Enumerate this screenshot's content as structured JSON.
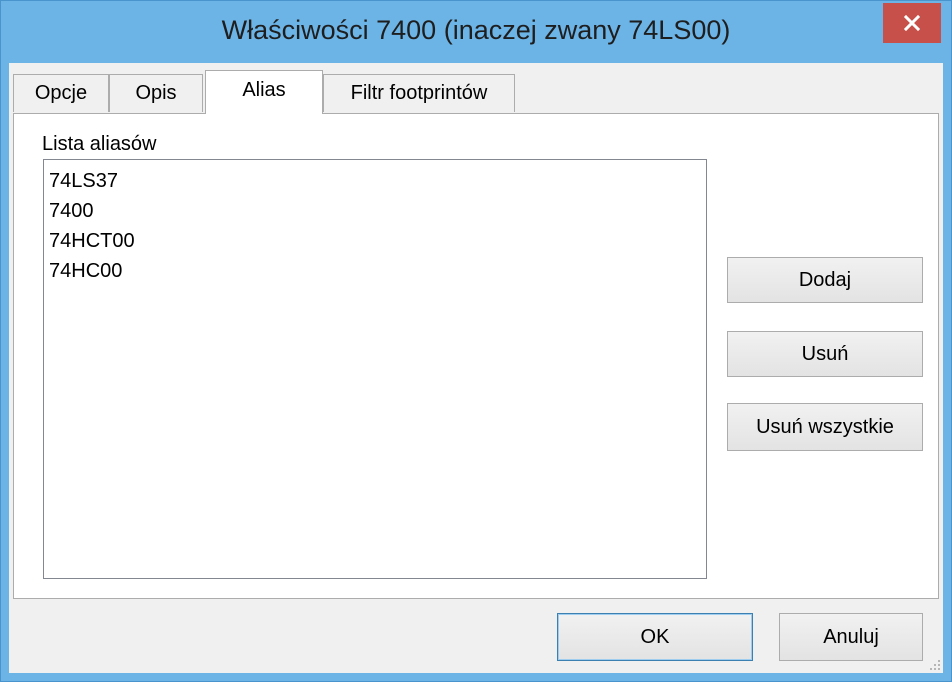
{
  "window": {
    "title": "Właściwości 7400 (inaczej zwany 74LS00)",
    "close_icon": "close-icon"
  },
  "tabs": [
    {
      "label": "Opcje",
      "active": false
    },
    {
      "label": "Opis",
      "active": false
    },
    {
      "label": "Alias",
      "active": true
    },
    {
      "label": "Filtr footprintów",
      "active": false
    }
  ],
  "alias_panel": {
    "list_label": "Lista aliasów",
    "items": [
      "74LS37",
      "7400",
      "74HCT00",
      "74HC00"
    ],
    "buttons": {
      "add": "Dodaj",
      "remove": "Usuń",
      "remove_all": "Usuń wszystkie"
    }
  },
  "footer": {
    "ok": "OK",
    "cancel": "Anuluj"
  },
  "colors": {
    "title_bar": "#6cb3e6",
    "close_button": "#c7504a",
    "dialog_bg": "#f0f0f0"
  }
}
